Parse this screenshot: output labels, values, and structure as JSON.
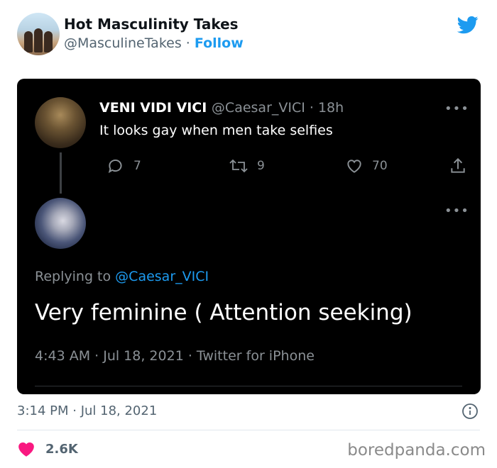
{
  "outer_tweet": {
    "display_name": "Hot Masculinity Takes",
    "handle": "@MasculineTakes",
    "separator": "·",
    "follow_label": "Follow",
    "timestamp": "3:14 PM · Jul 18, 2021",
    "like_count": "2.6K"
  },
  "embedded": {
    "first_tweet": {
      "display_name": "VENI VIDI VICI",
      "meta": "@Caesar_VICI · 18h",
      "text": "It looks gay when men take selfies",
      "more": "•••",
      "replies": "7",
      "retweets": "9",
      "likes": "70"
    },
    "reply": {
      "more": "•••",
      "replying_prefix": "Replying to",
      "replying_to": "@Caesar_VICI",
      "text": "Very feminine ( Attention seeking)",
      "timestamp": "4:43 AM · Jul 18, 2021 · Twitter for iPhone"
    }
  },
  "watermark": "boredpanda.com",
  "colors": {
    "twitter_blue": "#1d9bf0",
    "like_pink": "#f91880",
    "embed_bg": "#000000"
  },
  "icons": [
    "twitter-bird-icon",
    "reply-icon",
    "retweet-icon",
    "like-icon",
    "share-icon",
    "info-icon",
    "heart-icon",
    "more-icon"
  ]
}
